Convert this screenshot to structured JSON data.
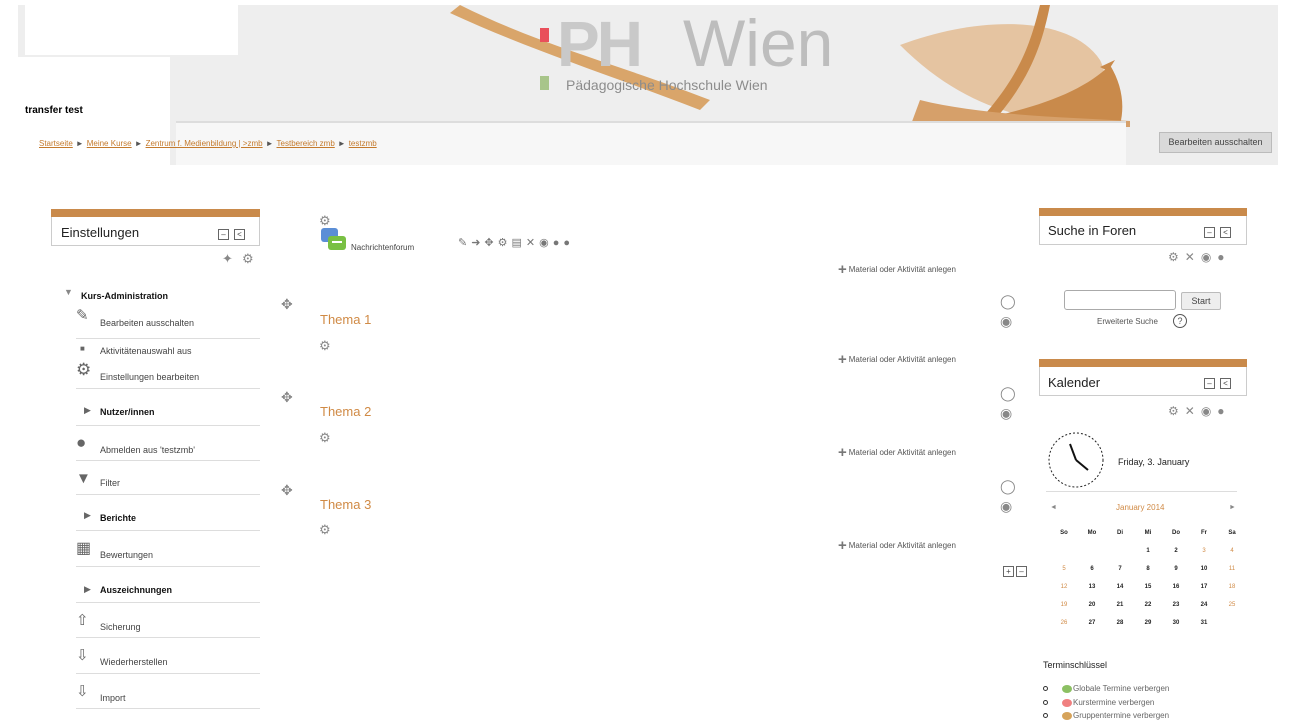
{
  "header": {
    "site_name": "transfer test",
    "logo_ph": "PH",
    "logo_wien": "Wien",
    "logo_subtitle": "Pädagogische Hochschule Wien",
    "edit_off_button": "Bearbeiten ausschalten"
  },
  "breadcrumb": {
    "items": [
      "Startseite",
      "Meine Kurse",
      "Zentrum f. Medienbildung | >zmb",
      "Testbereich zmb",
      "testzmb"
    ],
    "separator": "►"
  },
  "settings_block": {
    "title": "Einstellungen",
    "nav": [
      {
        "label": "Kurs-Administration",
        "icon": "triangle-down-icon",
        "bold": true
      },
      {
        "label": "Bearbeiten ausschalten",
        "icon": "pencil-icon"
      },
      {
        "label": "Aktivitätenauswahl aus",
        "icon": "square-bullet-icon"
      },
      {
        "label": "Einstellungen bearbeiten",
        "icon": "gear-icon"
      },
      {
        "label": "Nutzer/innen",
        "icon": "triangle-right-icon",
        "bold": true
      },
      {
        "label": "Abmelden aus 'testzmb'",
        "icon": "user-icon"
      },
      {
        "label": "Filter",
        "icon": "funnel-icon"
      },
      {
        "label": "Berichte",
        "icon": "triangle-right-icon",
        "bold": true
      },
      {
        "label": "Bewertungen",
        "icon": "table-icon"
      },
      {
        "label": "Auszeichnungen",
        "icon": "triangle-right-icon",
        "bold": true
      },
      {
        "label": "Sicherung",
        "icon": "upload-icon"
      },
      {
        "label": "Wiederherstellen",
        "icon": "download-icon"
      },
      {
        "label": "Import",
        "icon": "download-icon"
      }
    ]
  },
  "main": {
    "forum_label": "Nachrichtenforum",
    "add_activity_label": "Material oder Aktivität anlegen",
    "topics": [
      "Thema 1",
      "Thema 2",
      "Thema 3"
    ]
  },
  "search_block": {
    "title": "Suche in Foren",
    "input_value": "",
    "start_button": "Start",
    "advanced_search": "Erweiterte Suche"
  },
  "calendar_block": {
    "title": "Kalender",
    "date_text": "Friday, 3. January",
    "month_label": "January 2014",
    "prev_arrow": "◄",
    "next_arrow": "►",
    "weekdays": [
      "So",
      "Mo",
      "Di",
      "Mi",
      "Do",
      "Fr",
      "Sa"
    ],
    "weeks": [
      [
        "",
        "",
        "",
        "1",
        "2",
        "3",
        "4"
      ],
      [
        "5",
        "6",
        "7",
        "8",
        "9",
        "10",
        "11"
      ],
      [
        "12",
        "13",
        "14",
        "15",
        "16",
        "17",
        "18"
      ],
      [
        "19",
        "20",
        "21",
        "22",
        "23",
        "24",
        "25"
      ],
      [
        "26",
        "27",
        "28",
        "29",
        "30",
        "31",
        ""
      ]
    ],
    "legend_title": "Terminschlüssel",
    "legend": [
      {
        "label": "Globale Termine verbergen",
        "color": "#8cc063"
      },
      {
        "label": "Kurstermine verbergen",
        "color": "#f08080"
      },
      {
        "label": "Gruppentermine verbergen",
        "color": "#d6a35a"
      }
    ]
  },
  "colors": {
    "accent": "#c98a4b",
    "link": "#c47a2c",
    "topic": "#d08a45"
  }
}
